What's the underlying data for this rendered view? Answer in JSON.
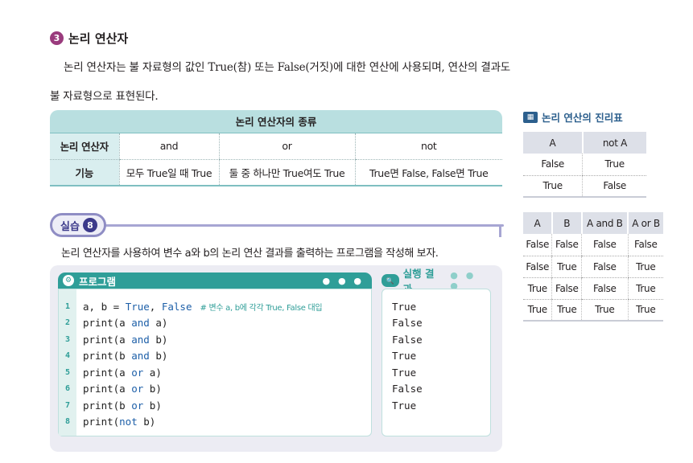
{
  "section": {
    "number": "3",
    "title": "논리 연산자",
    "body": "논리 연산자는 불 자료형의 값인 True(참) 또는 False(거짓)에 대한 연산에 사용되며, 연산의 결과도 불 자료형으로 표현된다."
  },
  "ops_table": {
    "caption": "논리 연산자의 종류",
    "row1": {
      "header": "논리 연산자",
      "cells": [
        "and",
        "or",
        "not"
      ]
    },
    "row2": {
      "header": "기능",
      "cells": [
        "모두 True일 때 True",
        "둘 중 하나만 True여도 True",
        "True면 False, False면 True"
      ]
    }
  },
  "sidebar": {
    "icon": "truth-table-icon",
    "title": "논리 연산의 진리표",
    "not_table": {
      "headers": [
        "A",
        "not A"
      ],
      "rows": [
        [
          "False",
          "True"
        ],
        [
          "True",
          "False"
        ]
      ]
    },
    "and_or_table": {
      "headers": [
        "A",
        "B",
        "A and B",
        "A or B"
      ],
      "rows": [
        [
          "False",
          "False",
          "False",
          "False"
        ],
        [
          "False",
          "True",
          "False",
          "True"
        ],
        [
          "True",
          "False",
          "False",
          "True"
        ],
        [
          "True",
          "True",
          "True",
          "True"
        ]
      ]
    }
  },
  "practice": {
    "label": "실습",
    "number": "8",
    "description": "논리 연산자를 사용하여 변수 a와 b의 논리 연산 결과를 출력하는 프로그램을 작성해 보자.",
    "program_title": "프로그램",
    "program_dots": "● ● ●",
    "result_title": "실행 결과",
    "result_dots": "● ● ●",
    "comment": "# 변수 a, b에 각각 True, False 대입",
    "code_lines": [
      {
        "num": "1",
        "text": "a, b = True, False"
      },
      {
        "num": "2",
        "text": "print(a and a)"
      },
      {
        "num": "3",
        "text": "print(a and b)"
      },
      {
        "num": "4",
        "text": "print(b and b)"
      },
      {
        "num": "5",
        "text": "print(a or a)"
      },
      {
        "num": "6",
        "text": "print(a or b)"
      },
      {
        "num": "7",
        "text": "print(b or b)"
      },
      {
        "num": "8",
        "text": "print(not b)"
      }
    ],
    "results": [
      "True",
      "False",
      "False",
      "True",
      "True",
      "False",
      "True"
    ]
  }
}
